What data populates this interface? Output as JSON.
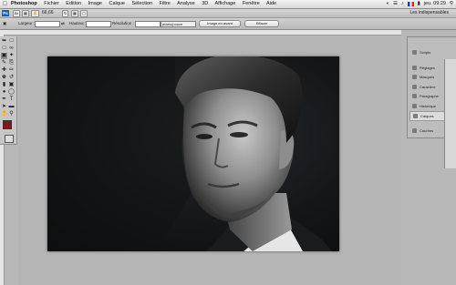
{
  "menubar": {
    "app": "Photoshop",
    "items": [
      "Fichier",
      "Edition",
      "Image",
      "Calque",
      "Sélection",
      "Filtre",
      "Analyse",
      "3D",
      "Affichage",
      "Fenêtre",
      "Aide"
    ],
    "clock": "jeu. 09:29"
  },
  "appbar": {
    "logo": "Ps",
    "zoom": "66,66",
    "workspace": "Les indispensables"
  },
  "options": {
    "largeur_label": "Largeur :",
    "hauteur_label": "Hauteur :",
    "resolution_label": "Résolution :",
    "resolution_unit": "pixels/pouce",
    "front_image_button": "Image en avant",
    "clear_button": "Effacer"
  },
  "panels": [
    {
      "label": "Scripts"
    },
    {
      "label": "Réglages"
    },
    {
      "label": "Masques"
    },
    {
      "label": "Caractère"
    },
    {
      "label": "Paragraphe"
    },
    {
      "label": "Historique"
    },
    {
      "label": "Calques"
    },
    {
      "label": "Courbes"
    }
  ],
  "colors": {
    "foreground": "#7e1420",
    "background": "#ffffff"
  }
}
